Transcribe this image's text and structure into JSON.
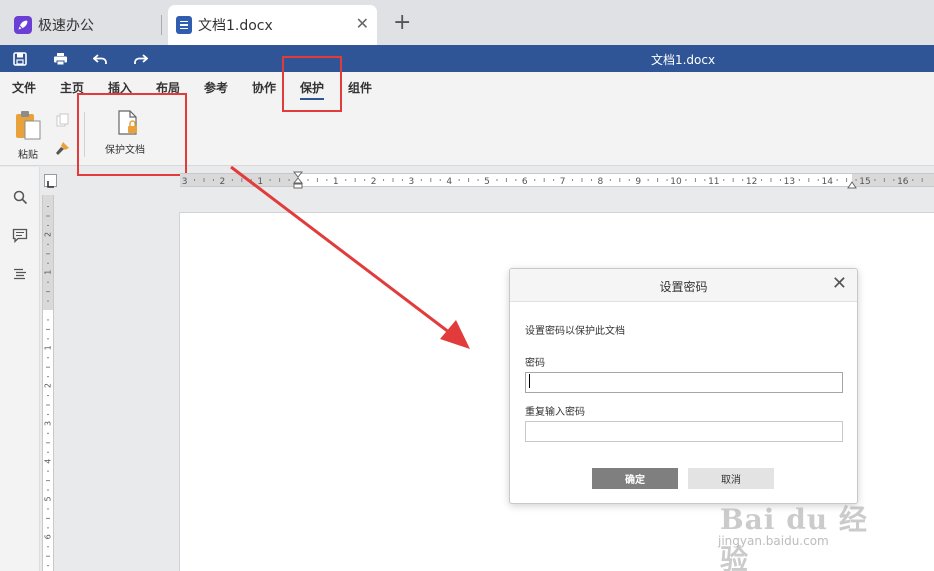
{
  "tabs": [
    {
      "label": "极速办公",
      "icon": "rocket-icon"
    },
    {
      "label": "文档1.docx",
      "icon": "document-icon"
    }
  ],
  "titlebar": {
    "title": "文档1.docx"
  },
  "menu": {
    "items": [
      "文件",
      "主页",
      "插入",
      "布局",
      "参考",
      "协作",
      "保护",
      "组件"
    ],
    "active": "保护"
  },
  "ribbon": {
    "paste_label": "粘贴",
    "protect_doc_label": "保护文档"
  },
  "ruler": {
    "h_labels": [
      "3",
      "2",
      "1",
      "1",
      "2",
      "3",
      "4",
      "5",
      "6",
      "7",
      "8",
      "9",
      "10",
      "11",
      "12",
      "13",
      "14",
      "15",
      "16"
    ],
    "v_labels": [
      "2",
      "1",
      "1",
      "2",
      "3",
      "4",
      "5",
      "6"
    ]
  },
  "dialog": {
    "title": "设置密码",
    "description": "设置密码以保护此文档",
    "password_label": "密码",
    "repeat_label": "重复输入密码",
    "password_value": "",
    "repeat_value": "",
    "ok_label": "确定",
    "cancel_label": "取消"
  },
  "watermark": {
    "main": "Bai du 经验",
    "sub": "jingyan.baidu.com"
  },
  "colors": {
    "accent": "#2f5597",
    "highlight": "#e23b3b",
    "ok_button": "#7f7f7f"
  }
}
